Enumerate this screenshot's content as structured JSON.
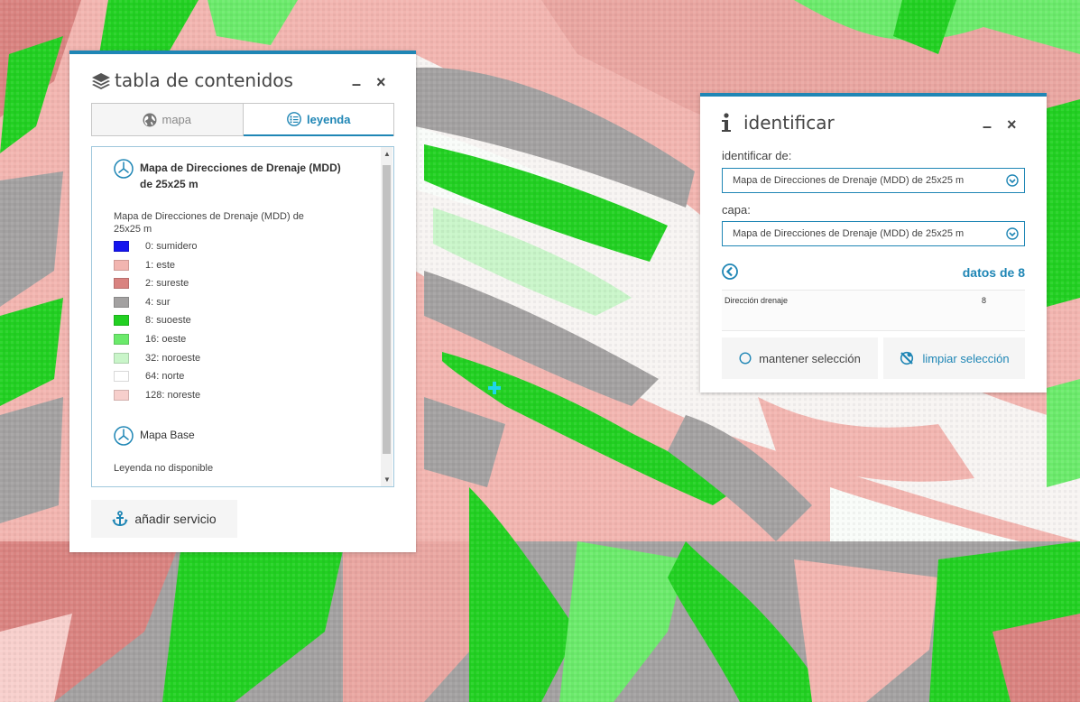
{
  "colors": {
    "accent": "#1f86b5",
    "map_pink": "#f2b5b0",
    "map_salmon": "#d98380",
    "map_gray": "#a3a1a1",
    "map_green": "#22d022",
    "map_lightgreen": "#6bea6b",
    "map_palegreen": "#c9f5c9",
    "map_white": "#f9fcf9",
    "crosshair": "#1ed6ea"
  },
  "map": {
    "crosshair_icon": "crosshair-icon"
  },
  "toc": {
    "title": "tabla de contenidos",
    "title_icon": "layers-icon",
    "minimize_label": "–",
    "close_label": "×",
    "tabs": [
      {
        "label": "mapa",
        "icon": "globe-icon",
        "active": false
      },
      {
        "label": "leyenda",
        "icon": "legend-icon",
        "active": true
      }
    ],
    "legend": {
      "layer_title": "Mapa de Direcciones de Drenaje (MDD) de 25x25 m",
      "layer_icon": "service-icon",
      "layer_subtitle": "Mapa de Direcciones de Drenaje (MDD) de 25x25 m",
      "items": [
        {
          "label": "0: sumidero",
          "color": "#1414ee"
        },
        {
          "label": "1: este",
          "color": "#f2b5b0"
        },
        {
          "label": "2: sureste",
          "color": "#d98380"
        },
        {
          "label": "4: sur",
          "color": "#a3a1a1"
        },
        {
          "label": "8: suoeste",
          "color": "#22d022"
        },
        {
          "label": "16: oeste",
          "color": "#6bea6b"
        },
        {
          "label": "32: noroeste",
          "color": "#c9f5c9"
        },
        {
          "label": "64: norte",
          "color": "#ffffff"
        },
        {
          "label": "128: noreste",
          "color": "#f7cfcc"
        }
      ],
      "base_title": "Mapa Base",
      "base_note": "Leyenda no disponible"
    },
    "add_service_label": "añadir servicio",
    "add_service_icon": "anchor-icon"
  },
  "identify": {
    "title": "identificar",
    "title_icon": "info-icon",
    "minimize_label": "–",
    "close_label": "×",
    "from_label": "identificar de:",
    "from_value": "Mapa de Direcciones de Drenaje (MDD) de 25x25 m",
    "layer_label": "capa:",
    "layer_value": "Mapa de Direcciones de Drenaje (MDD) de 25x25 m",
    "count_label": "datos de 8",
    "result": {
      "field": "Dirección drenaje",
      "value": "8"
    },
    "keep_label": "mantener selección",
    "clear_label": "limpiar selección"
  }
}
